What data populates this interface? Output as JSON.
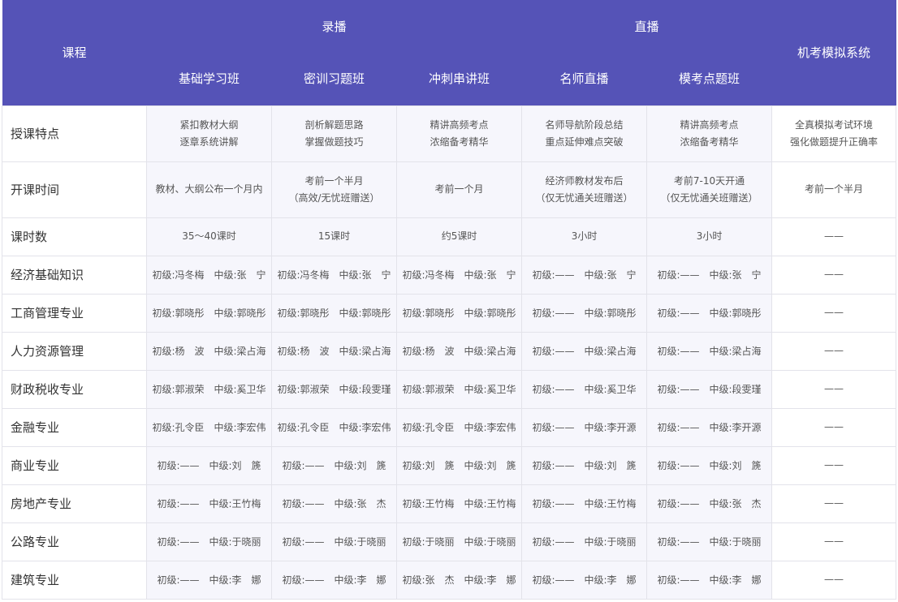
{
  "header": {
    "course_label": "课程",
    "group_recorded": "录播",
    "group_live": "直播",
    "simulation_label": "机考模拟系统",
    "columns": [
      "基础学习班",
      "密训习题班",
      "冲刺串讲班",
      "名师直播",
      "模考点题班"
    ]
  },
  "rows": [
    {
      "label": "授课特点",
      "cells": [
        [
          "紧扣教材大纲",
          "逐章系统讲解"
        ],
        [
          "剖析解题思路",
          "掌握做题技巧"
        ],
        [
          "精讲高频考点",
          "浓缩备考精华"
        ],
        [
          "名师导航阶段总结",
          "重点延伸难点突破"
        ],
        [
          "精讲高频考点",
          "浓缩备考精华"
        ],
        [
          "全真模拟考试环境",
          "强化做题提升正确率"
        ]
      ]
    },
    {
      "label": "开课时间",
      "cells": [
        [
          "教材、大纲公布一个月内"
        ],
        [
          "考前一个半月",
          "（高效/无忧班赠送）"
        ],
        [
          "考前一个月"
        ],
        [
          "经济师教材发布后",
          "（仅无忧通关班赠送）"
        ],
        [
          "考前7-10天开通",
          "（仅无忧通关班赠送）"
        ],
        [
          "考前一个半月"
        ]
      ]
    },
    {
      "label": "课时数",
      "cells": [
        [
          "35～40课时"
        ],
        [
          "15课时"
        ],
        [
          "约5课时"
        ],
        [
          "3小时"
        ],
        [
          "3小时"
        ],
        [
          "——"
        ]
      ]
    },
    {
      "label": "经济基础知识",
      "cells": [
        [
          "初级:冯冬梅",
          "中级:张　宁"
        ],
        [
          "初级:冯冬梅",
          "中级:张　宁"
        ],
        [
          "初级:冯冬梅",
          "中级:张　宁"
        ],
        [
          "初级:——",
          "中级:张　宁"
        ],
        [
          "初级:——",
          "中级:张　宁"
        ],
        [
          "——"
        ]
      ]
    },
    {
      "label": "工商管理专业",
      "cells": [
        [
          "初级:郭晓彤",
          "中级:郭晓彤"
        ],
        [
          "初级:郭晓彤",
          "中级:郭晓彤"
        ],
        [
          "初级:郭晓彤",
          "中级:郭晓彤"
        ],
        [
          "初级:——",
          "中级:郭晓彤"
        ],
        [
          "初级:——",
          "中级:郭晓彤"
        ],
        [
          "——"
        ]
      ]
    },
    {
      "label": "人力资源管理",
      "cells": [
        [
          "初级:杨　波",
          "中级:梁占海"
        ],
        [
          "初级:杨　波",
          "中级:梁占海"
        ],
        [
          "初级:杨　波",
          "中级:梁占海"
        ],
        [
          "初级:——",
          "中级:梁占海"
        ],
        [
          "初级:——",
          "中级:梁占海"
        ],
        [
          "——"
        ]
      ]
    },
    {
      "label": "财政税收专业",
      "cells": [
        [
          "初级:郭淑荣",
          "中级:奚卫华"
        ],
        [
          "初级:郭淑荣",
          "中级:段雯瑾"
        ],
        [
          "初级:郭淑荣",
          "中级:奚卫华"
        ],
        [
          "初级:——",
          "中级:奚卫华"
        ],
        [
          "初级:——",
          "中级:段雯瑾"
        ],
        [
          "——"
        ]
      ]
    },
    {
      "label": "金融专业",
      "cells": [
        [
          "初级:孔令臣",
          "中级:李宏伟"
        ],
        [
          "初级:孔令臣",
          "中级:李宏伟"
        ],
        [
          "初级:孔令臣",
          "中级:李宏伟"
        ],
        [
          "初级:——",
          "中级:李开源"
        ],
        [
          "初级:——",
          "中级:李开源"
        ],
        [
          "——"
        ]
      ]
    },
    {
      "label": "商业专业",
      "cells": [
        [
          "初级:——",
          "中级:刘　篪"
        ],
        [
          "初级:——",
          "中级:刘　篪"
        ],
        [
          "初级:刘　篪",
          "中级:刘　篪"
        ],
        [
          "初级:——",
          "中级:刘　篪"
        ],
        [
          "初级:——",
          "中级:刘　篪"
        ],
        [
          "——"
        ]
      ]
    },
    {
      "label": "房地产专业",
      "cells": [
        [
          "初级:——",
          "中级:王竹梅"
        ],
        [
          "初级:——",
          "中级:张　杰"
        ],
        [
          "初级:王竹梅",
          "中级:王竹梅"
        ],
        [
          "初级:——",
          "中级:王竹梅"
        ],
        [
          "初级:——",
          "中级:张　杰"
        ],
        [
          "——"
        ]
      ]
    },
    {
      "label": "公路专业",
      "cells": [
        [
          "初级:——",
          "中级:于晓丽"
        ],
        [
          "初级:——",
          "中级:于晓丽"
        ],
        [
          "初级:于晓丽",
          "中级:于晓丽"
        ],
        [
          "初级:——",
          "中级:于晓丽"
        ],
        [
          "初级:——",
          "中级:于晓丽"
        ],
        [
          "——"
        ]
      ]
    },
    {
      "label": "建筑专业",
      "cells": [
        [
          "初级:——",
          "中级:李　娜"
        ],
        [
          "初级:——",
          "中级:李　娜"
        ],
        [
          "初级:张　杰",
          "中级:李　娜"
        ],
        [
          "初级:——",
          "中级:李　娜"
        ],
        [
          "初级:——",
          "中级:李　娜"
        ],
        [
          "——"
        ]
      ]
    }
  ]
}
